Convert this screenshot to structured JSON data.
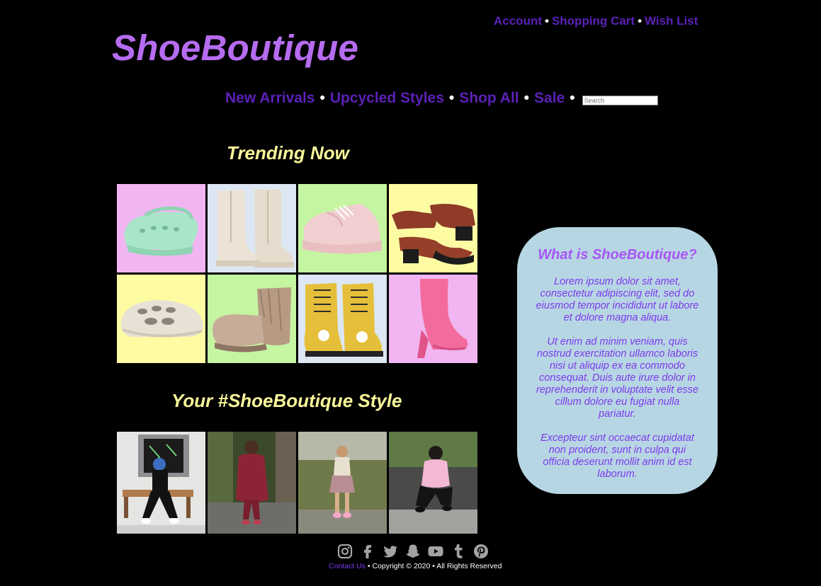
{
  "header": {
    "top_links": [
      "Account",
      "Shopping Cart",
      "Wish List"
    ],
    "separator": "•",
    "logo": "ShoeBoutique"
  },
  "nav": {
    "items": [
      "New Arrivals",
      "Upcycled Styles",
      "Shop All",
      "Sale"
    ],
    "search_placeholder": "Search"
  },
  "trending": {
    "title": "Trending Now",
    "tiles": [
      {
        "bg": "#f1b6f1",
        "item": "mint-clog"
      },
      {
        "bg": "#dde7f3",
        "item": "cream-boot"
      },
      {
        "bg": "#c6f5a2",
        "item": "pink-sneaker"
      },
      {
        "bg": "#fdfca3",
        "item": "brown-mary-jane"
      },
      {
        "bg": "#fdfca3",
        "item": "foam-runner"
      },
      {
        "bg": "#c6f5a2",
        "item": "fur-boot"
      },
      {
        "bg": "#dde7f3",
        "item": "yellow-boot"
      },
      {
        "bg": "#f1b6f1",
        "item": "pink-toe-boot"
      }
    ]
  },
  "style": {
    "title": "Your #ShoeBoutique Style",
    "photos": [
      "style-photo-1",
      "style-photo-2",
      "style-photo-3",
      "style-photo-4"
    ]
  },
  "about": {
    "title": "What is ShoeBoutique?",
    "paragraphs": [
      "Lorem ipsum dolor sit amet, consectetur adipiscing elit, sed do eiusmod tempor incididunt ut labore et dolore magna aliqua.",
      "Ut enim ad minim veniam, quis nostrud exercitation ullamco laboris nisi ut aliquip ex ea commodo consequat. Duis aute irure dolor in reprehenderit in voluptate velit esse cillum dolore eu fugiat nulla pariatur.",
      "Excepteur sint occaecat cupidatat non proident, sunt in culpa qui officia deserunt mollit anim id est laborum."
    ]
  },
  "social": [
    "instagram-icon",
    "facebook-icon",
    "twitter-icon",
    "snapchat-icon",
    "youtube-icon",
    "tumblr-icon",
    "pinterest-icon"
  ],
  "footer": {
    "contact": "Contact Us",
    "copyright": " • Copyright © 2020 • All Rights Reserved"
  },
  "colors": {
    "background": "#000000",
    "logo": "#b66cf0",
    "nav": "#5b21b6",
    "section_title": "#fbf79a",
    "info_box": "#b7d6e3",
    "info_text": "#7c3aed"
  }
}
